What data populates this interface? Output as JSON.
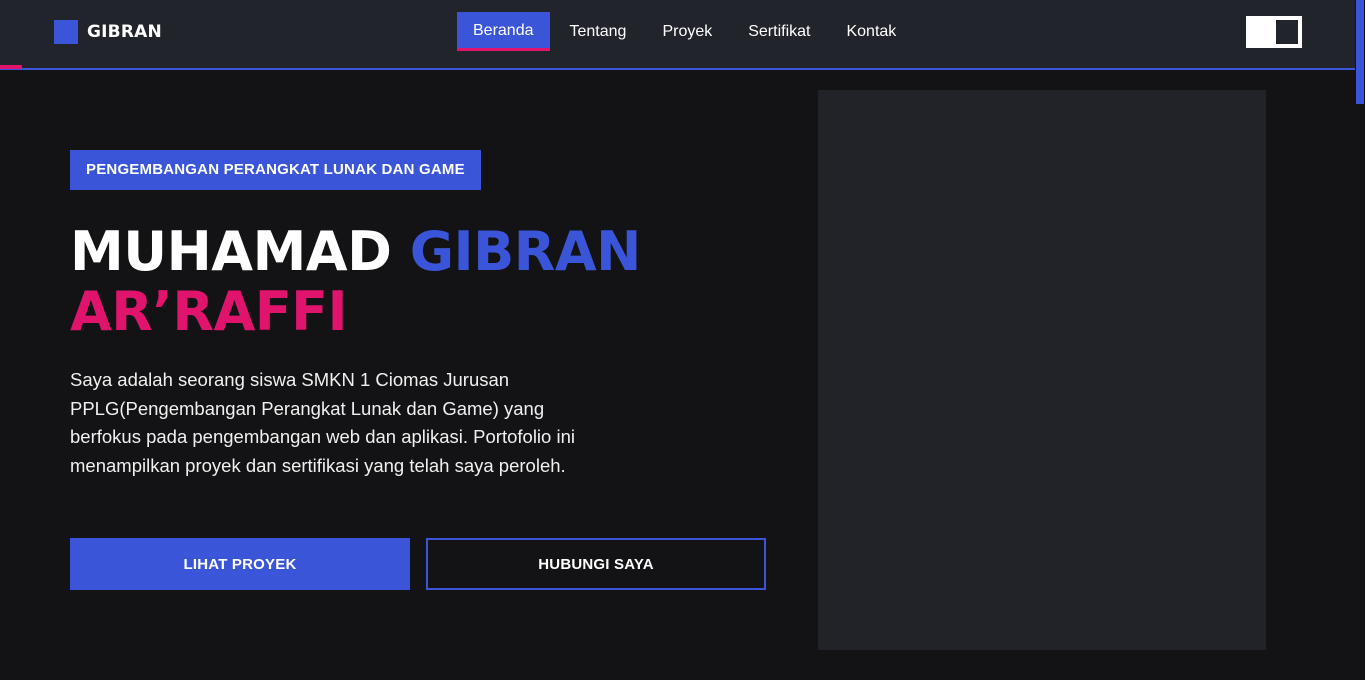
{
  "header": {
    "logo_text": "GIBRAN",
    "nav": [
      {
        "label": "Beranda",
        "active": true
      },
      {
        "label": "Tentang",
        "active": false
      },
      {
        "label": "Proyek",
        "active": false
      },
      {
        "label": "Sertifikat",
        "active": false
      },
      {
        "label": "Kontak",
        "active": false
      }
    ]
  },
  "hero": {
    "tag": "PENGEMBANGAN PERANGKAT LUNAK DAN GAME",
    "title_first": "MUHAMAD ",
    "title_highlight": "GIBRAN",
    "title_last": "AR’RAFFI",
    "description": "Saya adalah seorang siswa SMKN 1 Ciomas Jurusan PPLG(Pengembangan Perangkat Lunak dan Game) yang berfokus pada pengembangan web dan aplikasi. Portofolio ini menampilkan proyek dan sertifikasi yang telah saya peroleh.",
    "primary_button": "LIHAT PROYEK",
    "secondary_button": "HUBUNGI SAYA"
  },
  "colors": {
    "background": "#131315",
    "header": "#22242b",
    "accent_blue": "#3b55d9",
    "accent_pink": "#e0136d",
    "panel": "#212328"
  },
  "icons": {
    "logo": "square-logo-icon",
    "theme_toggle": "theme-toggle-switch"
  }
}
